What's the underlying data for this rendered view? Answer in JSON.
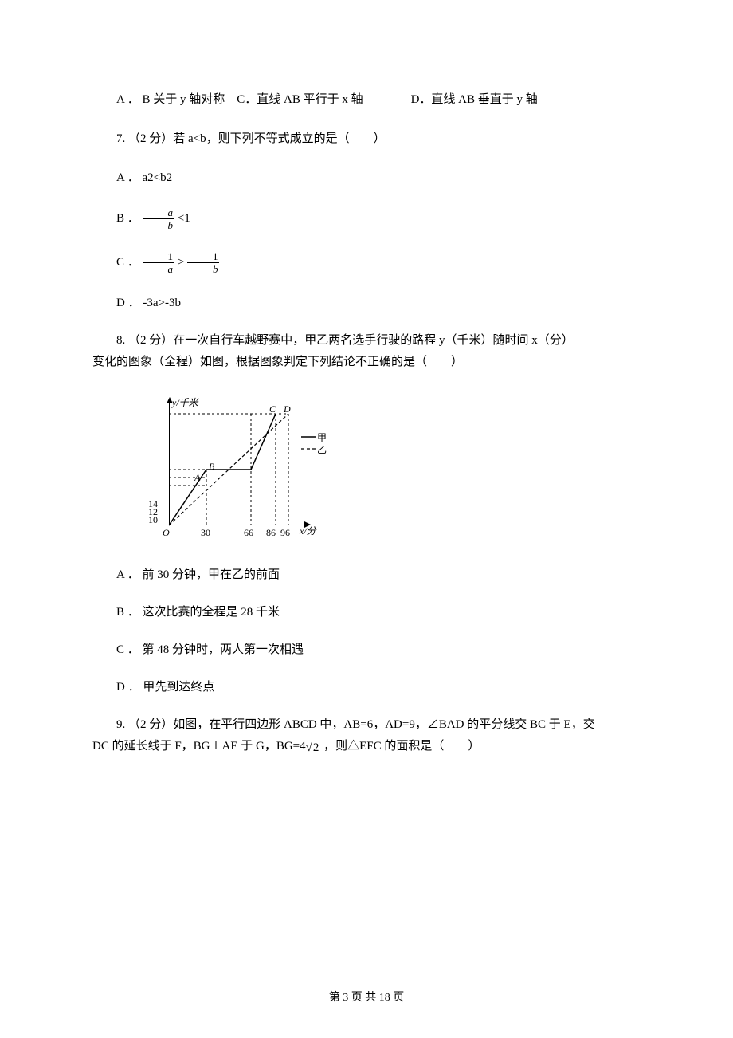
{
  "q6": {
    "tail": "A ． B 关于 y 轴对称　C．直线 AB 平行于 x 轴　　　　D．直线 AB 垂直于 y 轴"
  },
  "q7": {
    "stem": "7. （2 分）若 a<b，则下列不等式成立的是（　　）",
    "a_prefix": "A ． a2<b2",
    "b_prefix": "B ． ",
    "b_tail": " <1",
    "b_num": "a",
    "b_den": "b",
    "c_prefix": "C ． ",
    "c_lnum": "1",
    "c_lden": "a",
    "c_mid": " > ",
    "c_rnum": "1",
    "c_rden": "b",
    "d": "D ． -3a>-3b"
  },
  "q8": {
    "stem_line1": "8. （2 分）在一次自行车越野赛中，甲乙两名选手行驶的路程 y（千米）随时间 x（分）",
    "stem_line2": "变化的图象（全程）如图，根据图象判定下列结论不正确的是（　　）",
    "a": "A ． 前 30 分钟，甲在乙的前面",
    "b": "B ． 这次比赛的全程是 28 千米",
    "c": "C ． 第 48 分钟时，两人第一次相遇",
    "d": "D ． 甲先到达终点"
  },
  "q9": {
    "line1": "9. （2 分）如图，在平行四边形 ABCD 中，AB=6，AD=9，∠BAD 的平分线交 BC 于 E，交",
    "line2_pre": "DC 的延长线于 F，BG⊥AE 于 G，BG=4",
    "line2_rad": "2",
    "line2_post": " ，则△EFC 的面积是（　　）"
  },
  "fig": {
    "y_label": "y/千米",
    "x_label": "x/分",
    "y_ticks": [
      "10",
      "12",
      "14"
    ],
    "x_ticks": [
      "30",
      "66",
      "86",
      "96"
    ],
    "O": "O",
    "A": "A",
    "B": "B",
    "C": "C",
    "D": "D",
    "legend_jia": "甲",
    "legend_yi": "乙"
  },
  "footer": "第 3 页 共 18 页",
  "chart_data": {
    "type": "line",
    "xlabel": "x/分",
    "ylabel": "y/千米",
    "x_ticks": [
      0,
      30,
      66,
      86,
      96
    ],
    "y_ticks": [
      10,
      12,
      14
    ],
    "series": [
      {
        "name": "甲",
        "points": [
          [
            0,
            0
          ],
          [
            30,
            14
          ],
          [
            66,
            14
          ],
          [
            86,
            28
          ]
        ]
      },
      {
        "name": "乙",
        "points": [
          [
            0,
            0
          ],
          [
            96,
            28
          ]
        ]
      }
    ],
    "marked_points": {
      "A": [
        30,
        12
      ],
      "B": [
        30,
        14
      ],
      "C": [
        86,
        28
      ],
      "D": [
        96,
        28
      ]
    },
    "note": "y values at 28 inferred as top of chart (finish distance); not labeled on axis."
  }
}
